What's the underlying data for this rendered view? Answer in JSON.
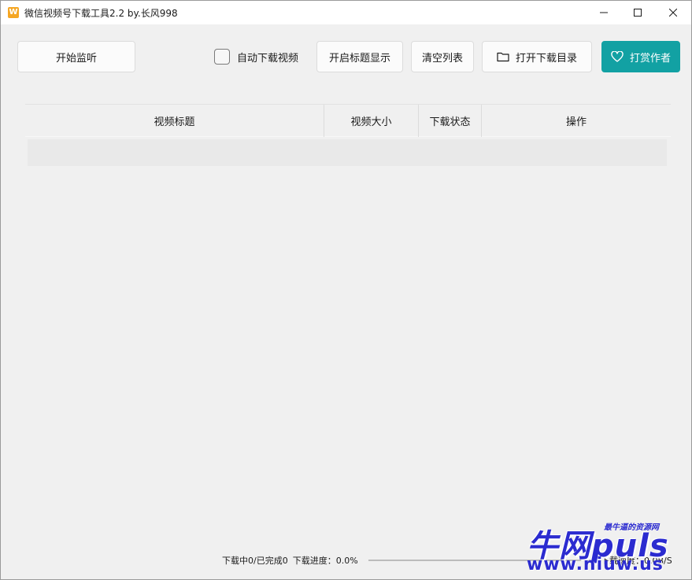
{
  "window": {
    "icon_letter": "W",
    "title": "微信视频号下载工具2.2 by.长风998"
  },
  "toolbar": {
    "start_label": "开始监听",
    "auto_download_label": "自动下载视频",
    "auto_download_checked": false,
    "show_title_label": "开启标题显示",
    "clear_label": "清空列表",
    "open_dir_label": "打开下载目录",
    "donate_label": "打赏作者"
  },
  "table": {
    "columns": [
      "视频标题",
      "视频大小",
      "下载状态",
      "操作"
    ],
    "rows": []
  },
  "status": {
    "counts_text": "下载中0/已完成0",
    "progress_text": "下载进度：0.0%",
    "progress_fraction": 0.0,
    "speed_text": "下载速度：0.0B/S"
  },
  "watermark": {
    "main": "牛网puls",
    "tag": "最牛逼的资源网",
    "url": "www.niuw.us"
  },
  "colors": {
    "accent": "#12a1a3",
    "window_bg": "#f0f0f0",
    "watermark": "#2b2bd0"
  },
  "icons": {
    "app": "app-logo-icon",
    "folder": "folder-icon",
    "heart": "heart-icon"
  }
}
